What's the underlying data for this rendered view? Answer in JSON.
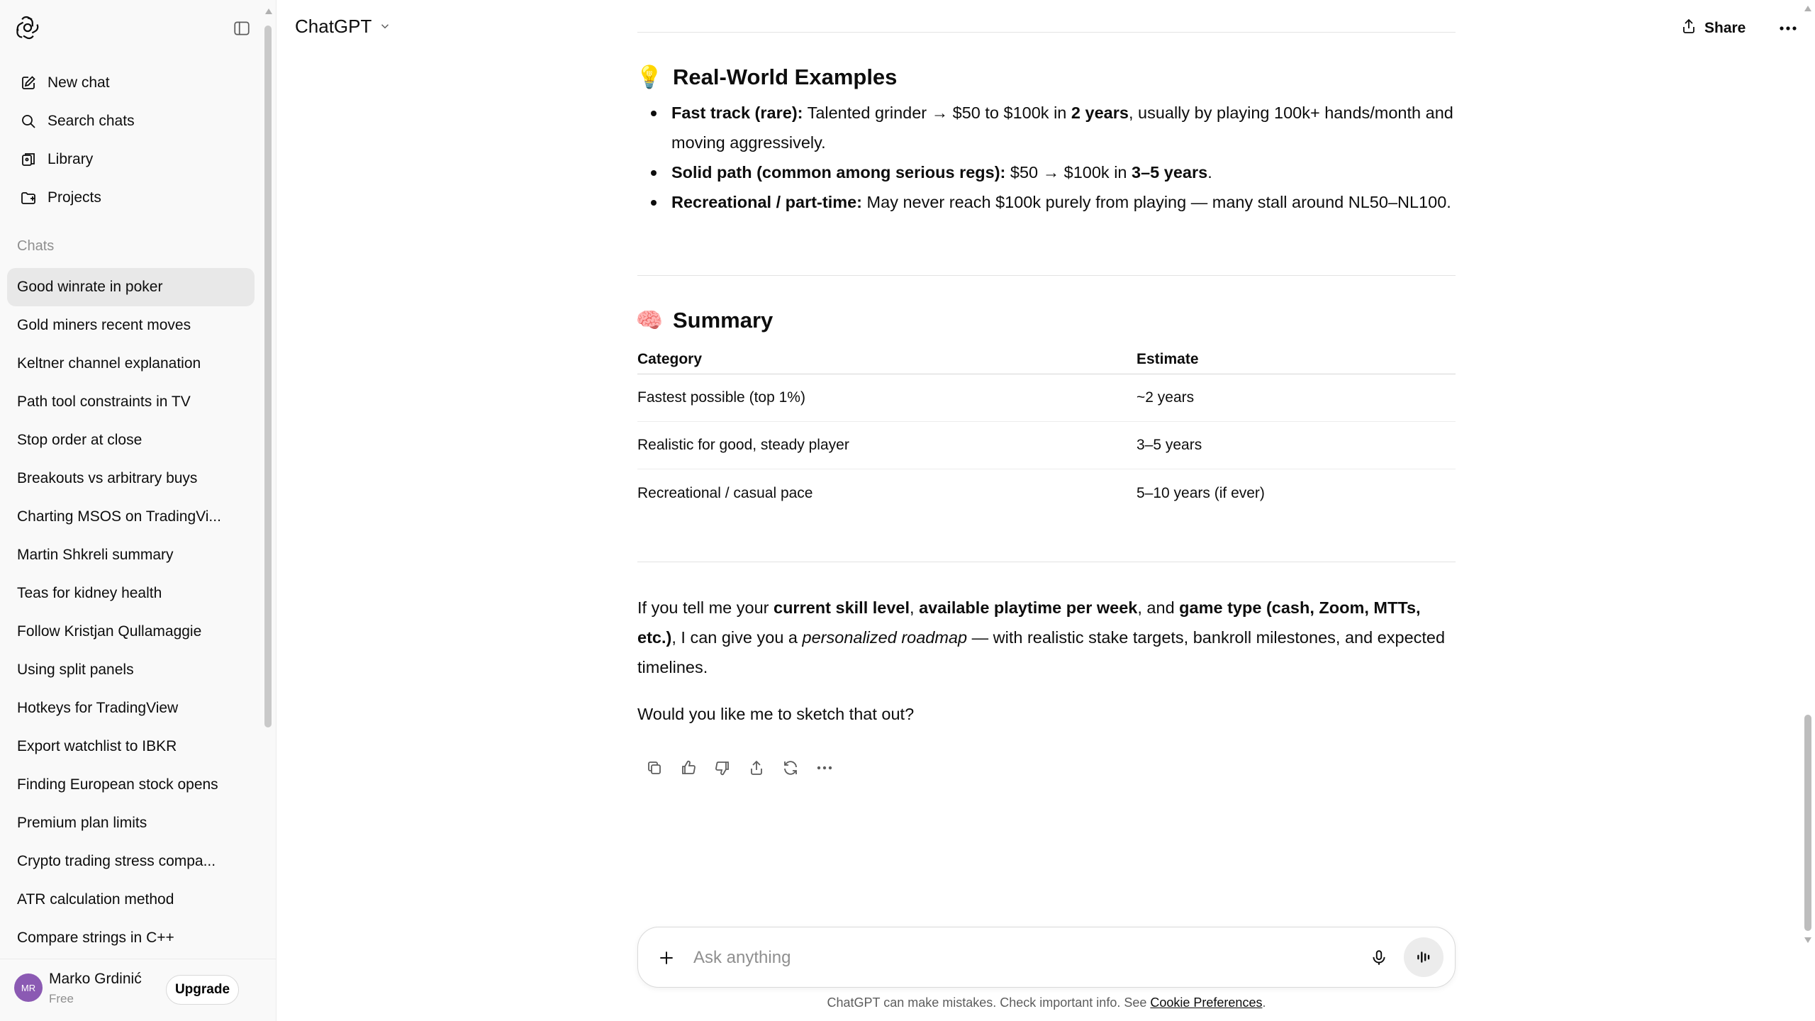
{
  "sidebar": {
    "nav": [
      {
        "label": "New chat",
        "icon": "new-chat-icon"
      },
      {
        "label": "Search chats",
        "icon": "search-icon"
      },
      {
        "label": "Library",
        "icon": "library-icon"
      },
      {
        "label": "Projects",
        "icon": "projects-icon"
      }
    ],
    "chats_heading": "Chats",
    "chats": [
      "Good winrate in poker",
      "Gold miners recent moves",
      "Keltner channel explanation",
      "Path tool constraints in TV",
      "Stop order at close",
      "Breakouts vs arbitrary buys",
      "Charting MSOS on TradingVi...",
      "Martin Shkreli summary",
      "Teas for kidney health",
      "Follow Kristjan Qullamaggie",
      "Using split panels",
      "Hotkeys for TradingView",
      "Export watchlist to IBKR",
      "Finding European stock opens",
      "Premium plan limits",
      "Crypto trading stress compa...",
      "ATR calculation method",
      "Compare strings in C++"
    ],
    "user": {
      "initials": "MR",
      "name": "Marko Grdinić",
      "plan": "Free",
      "upgrade_label": "Upgrade"
    }
  },
  "header": {
    "model": "ChatGPT",
    "share_label": "Share"
  },
  "conversation": {
    "examples": {
      "emoji": "💡",
      "title": "Real-World Examples",
      "items": [
        {
          "bold": "Fast track (rare):",
          "t1": " Talented grinder → $50 to $100k in ",
          "b2": "2 years",
          "t2": ", usually by playing 100k+ hands/month and moving aggressively."
        },
        {
          "bold": "Solid path (common among serious regs):",
          "t1": " $50 → $100k in ",
          "b2": "3–5 years",
          "t2": "."
        },
        {
          "bold": "Recreational / part-time:",
          "t1": " May never reach $100k purely from playing — many stall around NL50–NL100.",
          "b2": "",
          "t2": ""
        }
      ]
    },
    "summary": {
      "emoji": "🧠",
      "title": "Summary",
      "headers": [
        "Category",
        "Estimate"
      ],
      "rows": [
        [
          "Fastest possible (top 1%)",
          "~2 years"
        ],
        [
          "Realistic for good, steady player",
          "3–5 years"
        ],
        [
          "Recreational / casual pace",
          "5–10 years (if ever)"
        ]
      ]
    },
    "closing": {
      "p1_a": "If you tell me your ",
      "p1_b1": "current skill level",
      "p1_c": ", ",
      "p1_b2": "available playtime per week",
      "p1_d": ", and ",
      "p1_b3": "game type (cash, Zoom, MTTs, etc.)",
      "p1_e": ", I can give you a ",
      "p1_i": "personalized roadmap",
      "p1_f": " — with realistic stake targets, bankroll milestones, and expected timelines.",
      "p2": "Would you like me to sketch that out?"
    }
  },
  "composer": {
    "placeholder": "Ask anything"
  },
  "footer": {
    "disclaimer": "ChatGPT can make mistakes. Check important info. See ",
    "link": "Cookie Preferences",
    "end": "."
  }
}
